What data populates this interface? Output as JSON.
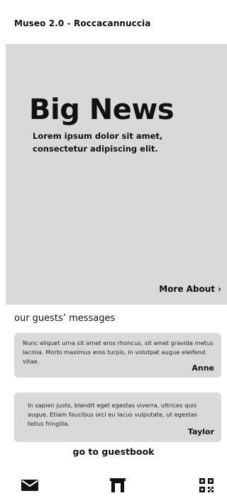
{
  "header": {
    "title": "Museo 2.0 - Roccacannuccia"
  },
  "hero": {
    "title": "Big News",
    "subtitle": "Lorem ipsum dolor sit amet, consectetur adipiscing elit.",
    "more_label": "More About",
    "more_icon": "chevron-right-icon"
  },
  "guests": {
    "title": "our guests’ messages",
    "messages": [
      {
        "text": "Nunc aliquet urna sit amet eros rhoncus, sit amet gravida metus lacinia. Morbi maximus eros turpis, in volutpat augue eleifend vitae.",
        "author": "Anne"
      },
      {
        "text": "In sapien justo, blandit eget egestas viverra, ultrices quis augue. Etiam faucibus orci eu lacus vulputate, ut egestas tellus fringilla.",
        "author": "Taylor"
      }
    ],
    "link_label": "go to guestbook"
  },
  "nav": {
    "items": [
      {
        "icon": "mail-icon"
      },
      {
        "icon": "museum-icon"
      },
      {
        "icon": "qr-code-icon"
      }
    ]
  }
}
